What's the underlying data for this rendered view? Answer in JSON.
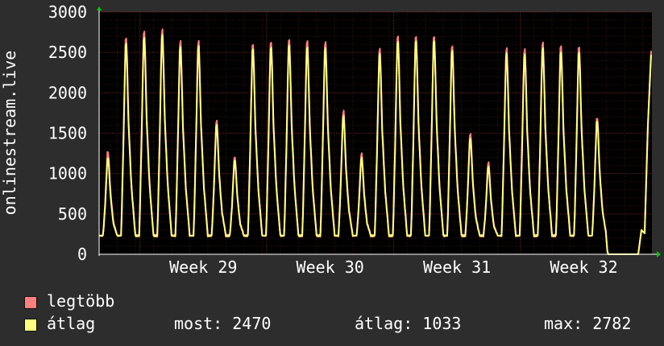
{
  "chart_data": {
    "type": "line",
    "ylabel": "onlinestream.live",
    "ylim": [
      0,
      3000
    ],
    "yticks": [
      0,
      500,
      1000,
      1500,
      2000,
      2500,
      3000
    ],
    "x_week_labels": [
      "Week 29",
      "Week 30",
      "Week 31",
      "Week 32"
    ],
    "grid": true,
    "series": [
      {
        "name": "legtöbb",
        "color": "#ff7f7f",
        "day_peaks": [
          1280,
          2700,
          2780,
          2800,
          2650,
          2650,
          1660,
          1210,
          2620,
          2650,
          2680,
          2660,
          2640,
          1780,
          1250,
          2560,
          2720,
          2720,
          2720,
          2600,
          1500,
          1140,
          2560,
          2550,
          2640,
          2600,
          2590,
          1700
        ]
      },
      {
        "name": "átlag",
        "color": "#ffff7f",
        "day_peaks": [
          1200,
          2630,
          2700,
          2730,
          2580,
          2590,
          1610,
          1170,
          2560,
          2580,
          2610,
          2580,
          2570,
          1720,
          1200,
          2500,
          2650,
          2660,
          2660,
          2540,
          1440,
          1090,
          2500,
          2490,
          2570,
          2520,
          2520,
          1660
        ]
      }
    ]
  },
  "legend": {
    "items": [
      {
        "label": "legtöbb",
        "color": "#ff7f7f"
      },
      {
        "label": "átlag",
        "color": "#ffff7f"
      }
    ],
    "stats": {
      "most": "most: 2470",
      "atlag": "átlag: 1033",
      "max": "max: 2782"
    }
  },
  "colors": {
    "background": "#2d2d2d",
    "plot_background": "#000000",
    "grid": "#5a1f1f",
    "axis_arrow": "#00cc00"
  }
}
